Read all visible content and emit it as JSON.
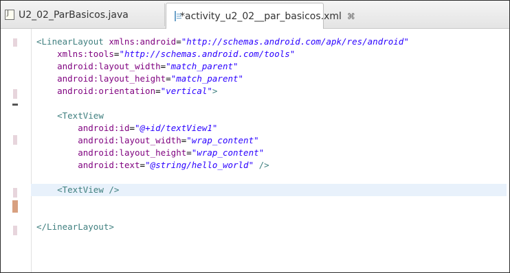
{
  "tabs": [
    {
      "label": "U2_02_ParBasicos.java",
      "icon": "java-file-icon",
      "active": false
    },
    {
      "label": "*activity_u2_02__par_basicos.xml",
      "icon": "xml-file-icon",
      "active": true,
      "close": "⌘"
    }
  ],
  "code_lines": [
    {
      "indent": "",
      "parts": [
        [
          "tag",
          "<LinearLayout "
        ],
        [
          "attr",
          "xmlns:android"
        ],
        [
          "plain",
          "="
        ],
        [
          "val",
          "\"http://schemas.android.com/apk/res/android\""
        ]
      ]
    },
    {
      "indent": "    ",
      "parts": [
        [
          "attr",
          "xmlns:tools"
        ],
        [
          "plain",
          "="
        ],
        [
          "val",
          "\"http://schemas.android.com/tools\""
        ]
      ]
    },
    {
      "indent": "    ",
      "parts": [
        [
          "attr",
          "android:layout_width"
        ],
        [
          "plain",
          "="
        ],
        [
          "val",
          "\"match_parent\""
        ]
      ]
    },
    {
      "indent": "    ",
      "parts": [
        [
          "attr",
          "android:layout_height"
        ],
        [
          "plain",
          "="
        ],
        [
          "val",
          "\"match_parent\""
        ]
      ]
    },
    {
      "indent": "    ",
      "parts": [
        [
          "attr",
          "android:orientation"
        ],
        [
          "plain",
          "="
        ],
        [
          "val",
          "\"vertical\""
        ],
        [
          "tag",
          ">"
        ]
      ]
    },
    {
      "indent": "",
      "parts": []
    },
    {
      "indent": "    ",
      "parts": [
        [
          "tag",
          "<TextView"
        ]
      ]
    },
    {
      "indent": "        ",
      "parts": [
        [
          "attr",
          "android:id"
        ],
        [
          "plain",
          "="
        ],
        [
          "val",
          "\"@+id/textView1\""
        ]
      ]
    },
    {
      "indent": "        ",
      "parts": [
        [
          "attr",
          "android:layout_width"
        ],
        [
          "plain",
          "="
        ],
        [
          "val",
          "\"wrap_content\""
        ]
      ]
    },
    {
      "indent": "        ",
      "parts": [
        [
          "attr",
          "android:layout_height"
        ],
        [
          "plain",
          "="
        ],
        [
          "val",
          "\"wrap_content\""
        ]
      ]
    },
    {
      "indent": "        ",
      "parts": [
        [
          "attr",
          "android:text"
        ],
        [
          "plain",
          "="
        ],
        [
          "val",
          "\"@string/hello_world\""
        ],
        [
          "tag",
          " />"
        ]
      ]
    },
    {
      "indent": "",
      "parts": []
    },
    {
      "indent": "    ",
      "parts": [
        [
          "tag",
          "<TextView />"
        ]
      ],
      "active": true
    },
    {
      "indent": "",
      "parts": []
    },
    {
      "indent": "",
      "parts": []
    },
    {
      "indent": "",
      "parts": [
        [
          "tag",
          "</LinearLayout>"
        ]
      ]
    }
  ],
  "colors": {
    "tag": "#3f7f7f",
    "attribute": "#7f007f",
    "value": "#2a00ff",
    "active_line": "#e8f1fb"
  }
}
